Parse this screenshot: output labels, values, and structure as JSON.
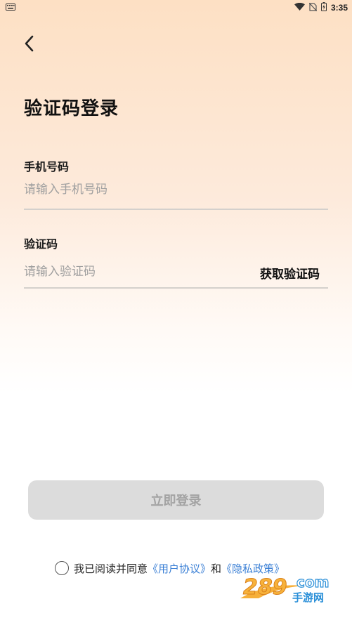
{
  "status_bar": {
    "time": "3:35"
  },
  "title": "验证码登录",
  "phone": {
    "label": "手机号码",
    "placeholder": "请输入手机号码"
  },
  "code": {
    "label": "验证码",
    "placeholder": "请输入验证码",
    "get_code_label": "获取验证码"
  },
  "login_button": "立即登录",
  "agreement": {
    "prefix": "我已阅读并同意",
    "user_agreement": "《用户协议》",
    "conjunction": "和",
    "privacy_policy": "《隐私政策》"
  },
  "watermark": {
    "brand": "289",
    "suffix": "com",
    "tagline": "手游网"
  },
  "icons": {
    "back": "chevron-left-icon",
    "keyboard": "keyboard-icon",
    "wifi": "wifi-icon",
    "no_sim": "no-sim-icon",
    "battery": "battery-icon",
    "checkbox": "radio-circle-icon"
  },
  "colors": {
    "link": "#3a7fd5",
    "button_bg": "#dcdcdc",
    "button_text": "#a3a3a3",
    "gradient_top": "#fde0c4"
  }
}
